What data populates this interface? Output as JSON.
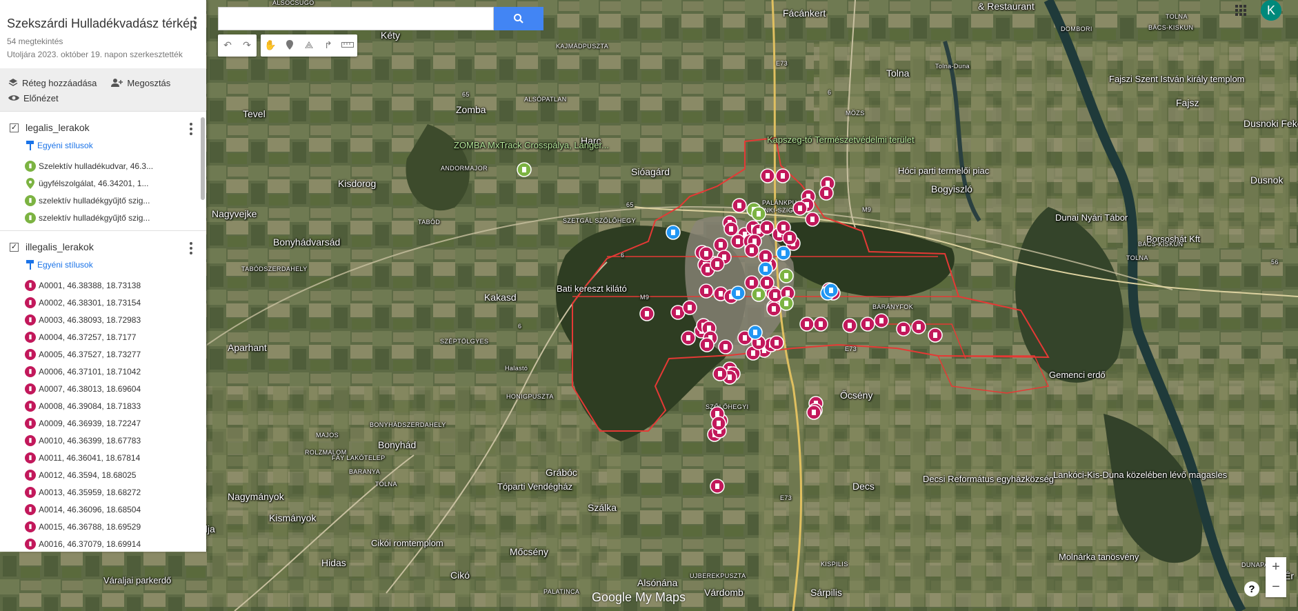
{
  "app": {
    "title": "Szekszárdi Hulladékvadász térkép",
    "views": "54 megtekintés",
    "edited": "Utoljára 2023. október 19. napon szerkesztették"
  },
  "actions": {
    "add_layer": "Réteg hozzáadása",
    "share": "Megosztás",
    "preview": "Előnézet"
  },
  "layers": [
    {
      "name": "legalis_lerakok",
      "style_label": "Egyéni stílusok",
      "items": [
        {
          "label": "Szelektív hulladékudvar, 46.3...",
          "icon": "green-bin-marker"
        },
        {
          "label": "ügyfélszolgálat, 46.34201, 1...",
          "icon": "green-pin-marker"
        },
        {
          "label": "szelektív hulladékgyűjtő szig...",
          "icon": "green-bin-marker"
        },
        {
          "label": "szelektív hulladékgyűjtő szig...",
          "icon": "green-bin-marker"
        }
      ]
    },
    {
      "name": "illegalis_lerakok",
      "style_label": "Egyéni stílusok",
      "items": [
        {
          "label": "A0001, 46.38388, 18.73138"
        },
        {
          "label": "A0002, 46.38301, 18.73154"
        },
        {
          "label": "A0003, 46.38093, 18.72983"
        },
        {
          "label": "A0004, 46.37257, 18.7177"
        },
        {
          "label": "A0005, 46.37527, 18.73277"
        },
        {
          "label": "A0006, 46.37101, 18.71042"
        },
        {
          "label": "A0007, 46.38013, 18.69604"
        },
        {
          "label": "A0008, 46.39084, 18.71833"
        },
        {
          "label": "A0009, 46.36939, 18.72247"
        },
        {
          "label": "A0010, 46.36399, 18.67783"
        },
        {
          "label": "A0011, 46.36041, 18.67814"
        },
        {
          "label": "A0012, 46.3594, 18.68025"
        },
        {
          "label": "A0013, 46.35959, 18.68272"
        },
        {
          "label": "A0014, 46.36096, 18.68504"
        },
        {
          "label": "A0015, 46.36788, 18.69529"
        },
        {
          "label": "A0016, 46.37079, 18.69914"
        }
      ]
    }
  ],
  "user": {
    "initial": "K"
  },
  "zoom": {
    "in": "+",
    "out": "−"
  },
  "help": "?",
  "logo": "Google My Maps",
  "colors": {
    "illegal": "#c2185b",
    "legal": "#7cb342",
    "blue": "#2196f3",
    "boundary": "#e53935"
  },
  "map_labels": [
    "ALSÓCSÚGÓ",
    "Fácánkert",
    "& Restaurant",
    "DOMBORI",
    "TOLNA",
    "BÁCS-KISKUN",
    "Kéty",
    "KAJMÁDPUSZTA",
    "Tolna",
    "Tolna-Duna",
    "Fajszi Szent István király templom",
    "Fajsz",
    "Zomba",
    "ALSÓPATLAN",
    "MÖZS",
    "Tevel",
    "Harc",
    "Dusnoki Feke",
    "ZOMBA MxTrack Crosspálya, Langer...",
    "ANDORMAJOR",
    "Kapszeg-tó Természetvédelmi terület",
    "Hóci parti termelői piac",
    "Sióagárd",
    "Dusnok",
    "Kisdorog",
    "PALÁNKPU",
    "NKI-SZIGE",
    "Bogyiszló",
    "Nagyvejke",
    "SZETGÁL SZŐLŐHEGY",
    "TABÓD",
    "Dunai Nyári Tábor",
    "Bonyhádvarsád",
    "Borsoshát Kft",
    "BÁCS-KISKUN",
    "TOLNA",
    "TABÓDSZERDAHELY",
    "Bati kereszt kilátó",
    "Kakasd",
    "BÁRÁNYFOK",
    "Aparhant",
    "SZÉPTÖLGYES",
    "Halastó",
    "Gemenci erdő",
    "HONIGPUSZTA",
    "Őcsény",
    "SZŐLŐHEGYI",
    "BONYHÁDSZERDAHELY",
    "MAJOS",
    "Bonyhád",
    "ROLZMALOM",
    "FÁY LAKÓTELEP",
    "BARANYA",
    "TOLNA",
    "Grábóc",
    "Decsi Református egyházközség",
    "Decs",
    "Lankóci-Kis-Duna közelében lévő magasles",
    "Nagymányok",
    "Tóparti Vendégház",
    "Szálka",
    "Kismányok",
    "Cikói romtemplom",
    "Mőcsény",
    "Molnárka tanösvény",
    "Hidas",
    "Cikó",
    "KISPILIS",
    "DUNAPART",
    "Váraljai parkerdő",
    "Alsónána",
    "UJBEREKPUSZTA",
    "PALATINCA",
    "Várdomb",
    "Sárpilis",
    "alja",
    "Ér",
    "E73",
    "M9",
    "M9",
    "E73",
    "E73",
    "65",
    "65",
    "6",
    "6",
    "6",
    "6",
    "56",
    "51"
  ]
}
